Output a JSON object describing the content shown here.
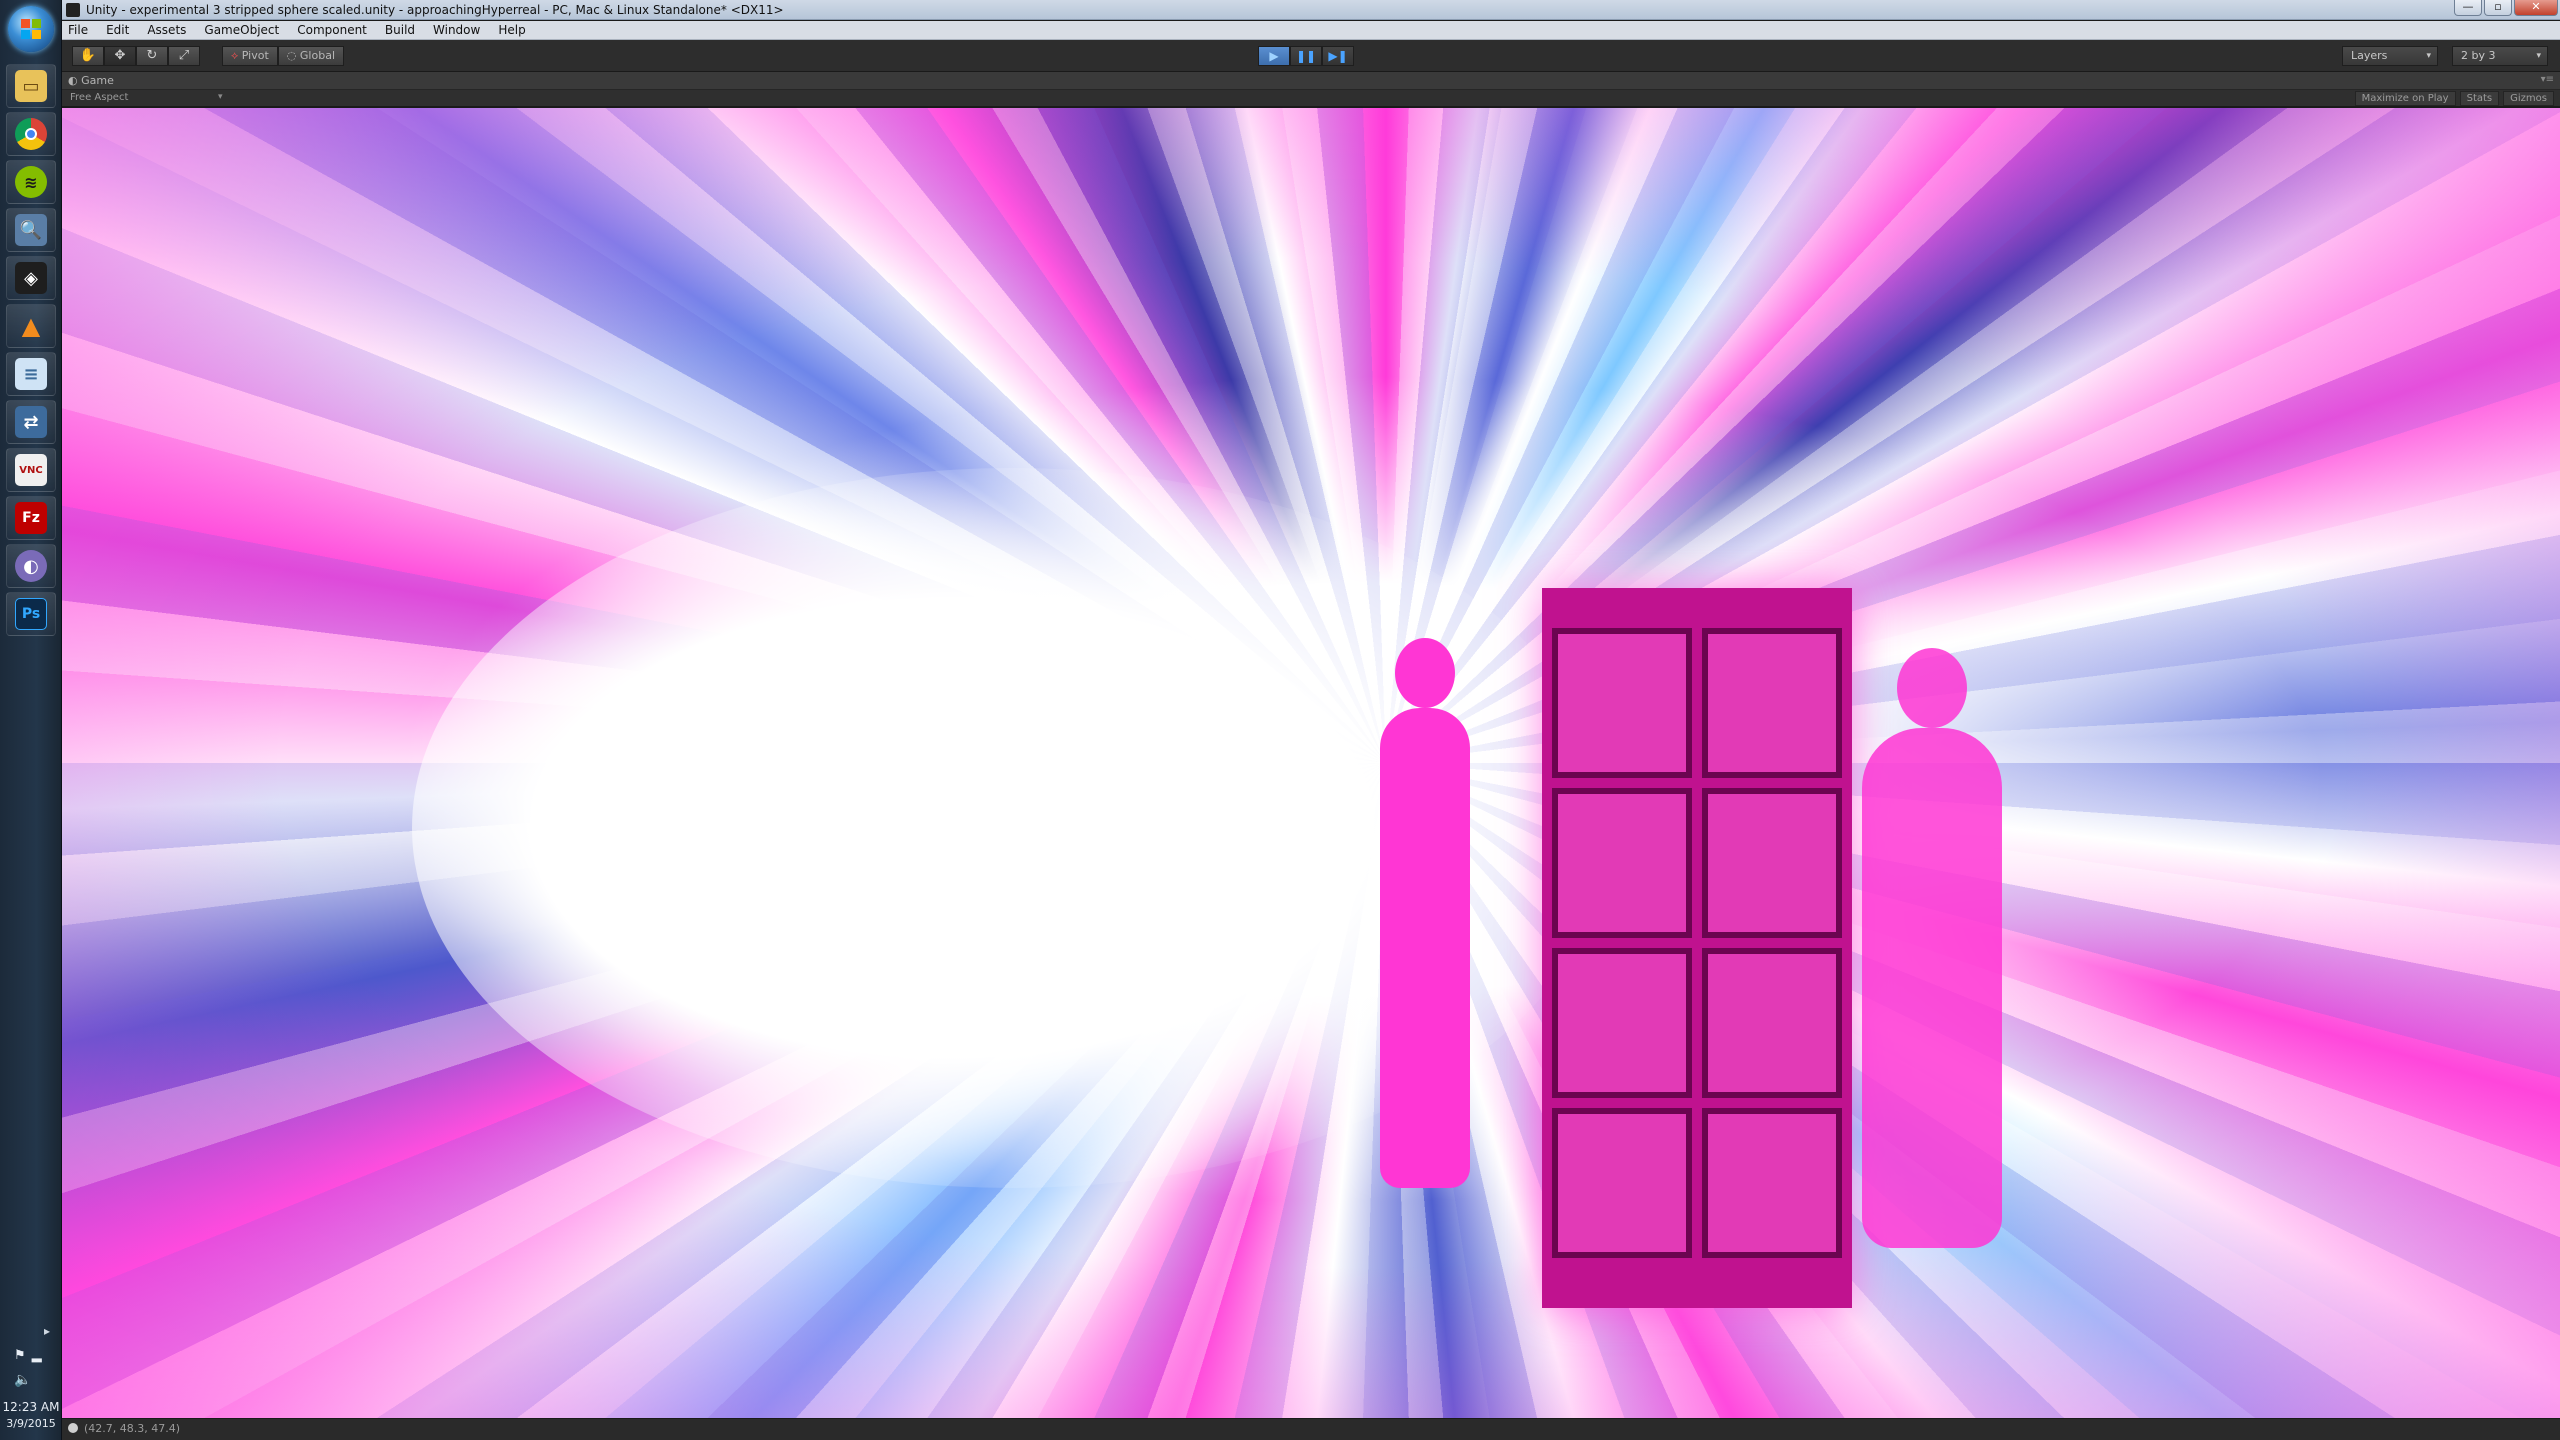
{
  "window": {
    "title": "Unity - experimental 3 stripped sphere scaled.unity - approachingHyperreal - PC, Mac & Linux Standalone* <DX11>"
  },
  "menu": [
    "File",
    "Edit",
    "Assets",
    "GameObject",
    "Component",
    "Build",
    "Window",
    "Help"
  ],
  "toolbar": {
    "pivot_label": "Pivot",
    "global_label": "Global",
    "layers_label": "Layers",
    "layout_label": "2 by 3"
  },
  "game_view": {
    "tab_label": "Game",
    "aspect_label": "Free Aspect",
    "maximize_label": "Maximize on Play",
    "stats_label": "Stats",
    "gizmos_label": "Gizmos"
  },
  "status_bar": {
    "text": "(42.7, 48.3, 47.4)"
  },
  "taskbar": {
    "time": "12:23 AM",
    "date": "3/9/2015",
    "apps": [
      "explorer-icon",
      "chrome-icon",
      "spotify-icon",
      "search-app-icon",
      "unity-icon",
      "vlc-icon",
      "notepad-icon",
      "network-icon",
      "vnc-icon",
      "filezilla-icon",
      "app-icon",
      "photoshop-icon"
    ],
    "ps_label": "Ps",
    "vnc_label": "VNC",
    "fz_label": "Fz"
  },
  "colors": {
    "accent_magenta": "#ff36d4",
    "accent_blue": "#5a6ad8",
    "play_blue": "#4aa3ff"
  }
}
